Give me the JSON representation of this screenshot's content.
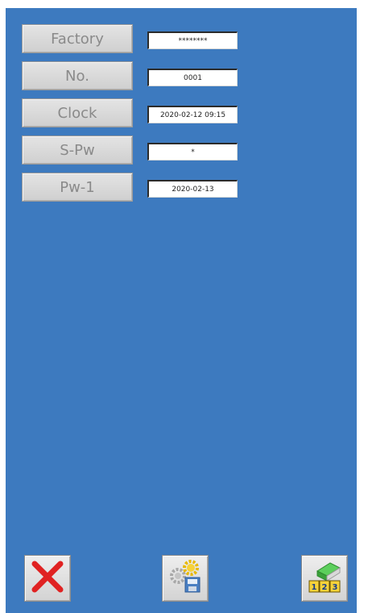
{
  "settings": [
    {
      "label": "Factory",
      "value": "********"
    },
    {
      "label": "No.",
      "value": "0001"
    },
    {
      "label": "Clock",
      "value": "2020-02-12 09:15"
    },
    {
      "label": "S-Pw",
      "value": "*"
    },
    {
      "label": "Pw-1",
      "value": "2020-02-13"
    }
  ],
  "toolbar": {
    "cancel_icon": "red-x-icon",
    "settings_save_icon": "gear-save-icon",
    "number_input_icon": "eraser-123-icon"
  },
  "colors": {
    "background": "#3d7abf",
    "cancel_red": "#e02222"
  }
}
